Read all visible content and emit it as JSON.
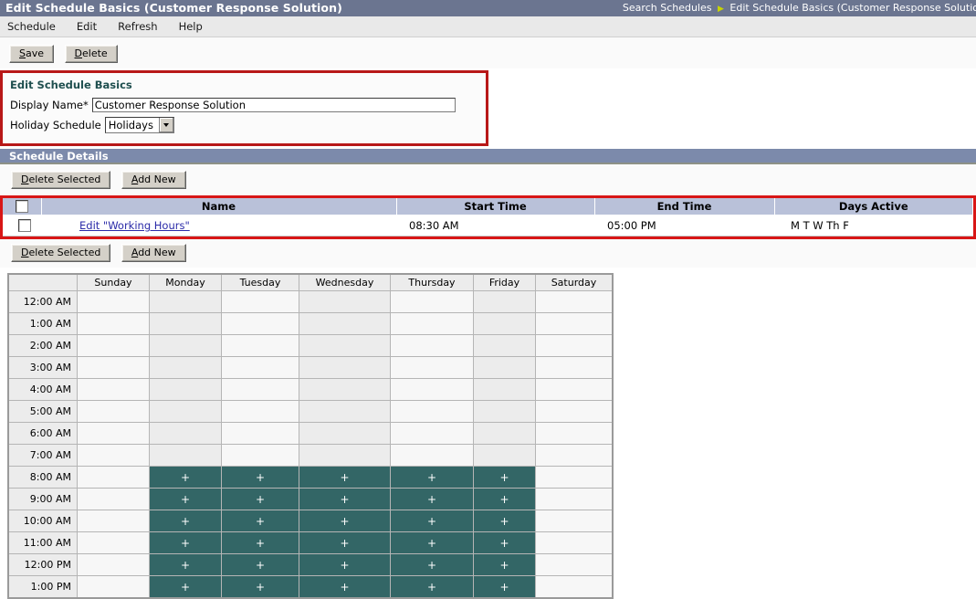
{
  "window": {
    "title": "Edit Schedule Basics  (Customer Response Solution)",
    "breadcrumb_first": "Search Schedules",
    "breadcrumb_sep": "▶",
    "breadcrumb_second": "Edit Schedule Basics  (Customer Response Solutio"
  },
  "menubar": {
    "items": [
      {
        "label": "Schedule"
      },
      {
        "label": "Edit"
      },
      {
        "label": "Refresh"
      },
      {
        "label": "Help"
      }
    ]
  },
  "toolbar": {
    "save_label": "Save",
    "save_accel": "S",
    "save_rest": "ave",
    "delete_label": "Delete",
    "delete_accel": "D",
    "delete_rest": "elete"
  },
  "basics": {
    "panel_title": "Edit Schedule Basics",
    "display_name_label": "Display Name*",
    "display_name_value": "Customer Response Solution",
    "holiday_label": "Holiday Schedule",
    "holiday_value": "Holidays",
    "holiday_options": [
      "Holidays"
    ]
  },
  "details": {
    "section_title": "Schedule Details",
    "delete_selected_accel": "D",
    "delete_selected_rest": "elete Selected",
    "add_new_accel": "A",
    "add_new_rest": "dd New",
    "columns": [
      "Name",
      "Start Time",
      "End Time",
      "Days Active"
    ],
    "rows": [
      {
        "name": "Edit \"Working Hours\"",
        "start_time": "08:30 AM",
        "end_time": "05:00 PM",
        "days_active": "M T W Th F",
        "checked": false
      }
    ]
  },
  "calendar": {
    "days": [
      "Sunday",
      "Monday",
      "Tuesday",
      "Wednesday",
      "Thursday",
      "Friday",
      "Saturday"
    ],
    "times": [
      "12:00 AM",
      "1:00 AM",
      "2:00 AM",
      "3:00 AM",
      "4:00 AM",
      "5:00 AM",
      "6:00 AM",
      "7:00 AM",
      "8:00 AM",
      "9:00 AM",
      "10:00 AM",
      "11:00 AM",
      "12:00 PM",
      "1:00 PM"
    ],
    "active_marker": "+",
    "active_color": "#336666",
    "active_cells": [
      [
        false,
        false,
        false,
        false,
        false,
        false,
        false
      ],
      [
        false,
        false,
        false,
        false,
        false,
        false,
        false
      ],
      [
        false,
        false,
        false,
        false,
        false,
        false,
        false
      ],
      [
        false,
        false,
        false,
        false,
        false,
        false,
        false
      ],
      [
        false,
        false,
        false,
        false,
        false,
        false,
        false
      ],
      [
        false,
        false,
        false,
        false,
        false,
        false,
        false
      ],
      [
        false,
        false,
        false,
        false,
        false,
        false,
        false
      ],
      [
        false,
        false,
        false,
        false,
        false,
        false,
        false
      ],
      [
        false,
        true,
        true,
        true,
        true,
        true,
        false
      ],
      [
        false,
        true,
        true,
        true,
        true,
        true,
        false
      ],
      [
        false,
        true,
        true,
        true,
        true,
        true,
        false
      ],
      [
        false,
        true,
        true,
        true,
        true,
        true,
        false
      ],
      [
        false,
        true,
        true,
        true,
        true,
        true,
        false
      ],
      [
        false,
        true,
        true,
        true,
        true,
        true,
        false
      ]
    ]
  },
  "colors": {
    "titlebar": "#6b7590",
    "section_bar": "#7c8aab",
    "table_header": "#b9c1d9",
    "annotation_red": "#d81616",
    "panel_heading": "#1f4f4f",
    "link": "#2a2aa8"
  }
}
